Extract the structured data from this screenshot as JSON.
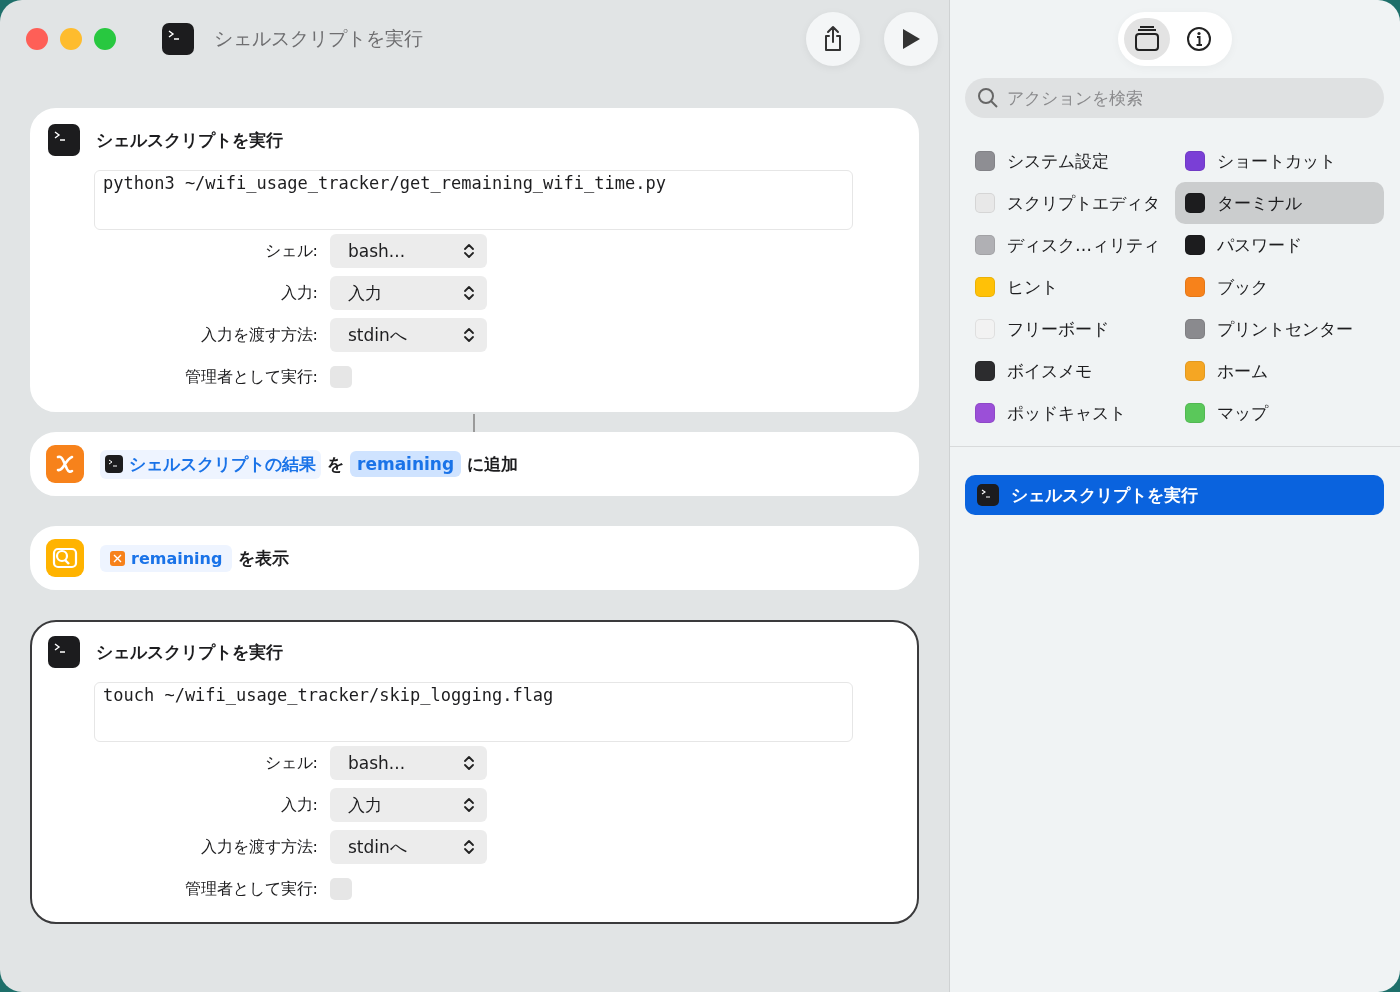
{
  "window": {
    "title": "シェルスクリプトを実行"
  },
  "actions": [
    {
      "kind": "shell",
      "title": "シェルスクリプトを実行",
      "script": "python3 ~/wifi_usage_tracker/get_remaining_wifi_time.py",
      "selected": false,
      "options": [
        {
          "kind": "select",
          "label": "シェル:",
          "value": "bash..."
        },
        {
          "kind": "select",
          "label": "入力:",
          "value": "入力"
        },
        {
          "kind": "select",
          "label": "入力を渡す方法:",
          "value": "stdinへ"
        },
        {
          "kind": "checkbox",
          "label": "管理者として実行:",
          "checked": false
        }
      ]
    },
    {
      "kind": "add_variable",
      "input": "シェルスクリプトの結果",
      "joiner": "を",
      "variable": "remaining",
      "suffix": "に追加",
      "selected": false
    },
    {
      "kind": "show_result",
      "variable": "remaining",
      "suffix": "を表示",
      "selected": false
    },
    {
      "kind": "shell",
      "title": "シェルスクリプトを実行",
      "script": "touch ~/wifi_usage_tracker/skip_logging.flag",
      "selected": true,
      "options": [
        {
          "kind": "select",
          "label": "シェル:",
          "value": "bash..."
        },
        {
          "kind": "select",
          "label": "入力:",
          "value": "入力"
        },
        {
          "kind": "select",
          "label": "入力を渡す方法:",
          "value": "stdinへ"
        },
        {
          "kind": "checkbox",
          "label": "管理者として実行:",
          "checked": false
        }
      ]
    }
  ],
  "sidebar": {
    "tabs": [
      {
        "kind": "library",
        "selected": true
      },
      {
        "kind": "info",
        "selected": false
      }
    ],
    "search": {
      "placeholder": "アクションを検索"
    },
    "apps": [
      {
        "name": "システム設定",
        "color": "#8e8e93",
        "selected": false
      },
      {
        "name": "ショートカット",
        "color": "#7a3fd6",
        "selected": false
      },
      {
        "name": "スクリプトエディタ",
        "color": "#e8e8e8",
        "selected": false
      },
      {
        "name": "ターミナル",
        "color": "#1c1c1e",
        "selected": true
      },
      {
        "name": "ディスク…ィリティ",
        "color": "#b0b0b4",
        "selected": false
      },
      {
        "name": "パスワード",
        "color": "#1c1c1e",
        "selected": false
      },
      {
        "name": "ヒント",
        "color": "#ffc107",
        "selected": false
      },
      {
        "name": "ブック",
        "color": "#f7821b",
        "selected": false
      },
      {
        "name": "フリーボード",
        "color": "#f2f2f2",
        "selected": false
      },
      {
        "name": "プリントセンター",
        "color": "#8a8a8e",
        "selected": false
      },
      {
        "name": "ボイスメモ",
        "color": "#2c2c2e",
        "selected": false
      },
      {
        "name": "ホーム",
        "color": "#f5a623",
        "selected": false
      },
      {
        "name": "ポッドキャスト",
        "color": "#9b4fd8",
        "selected": false
      },
      {
        "name": "マップ",
        "color": "#5ac85a",
        "selected": false
      }
    ],
    "suggestions": [
      {
        "name": "シェルスクリプトを実行",
        "selected": true
      }
    ]
  }
}
